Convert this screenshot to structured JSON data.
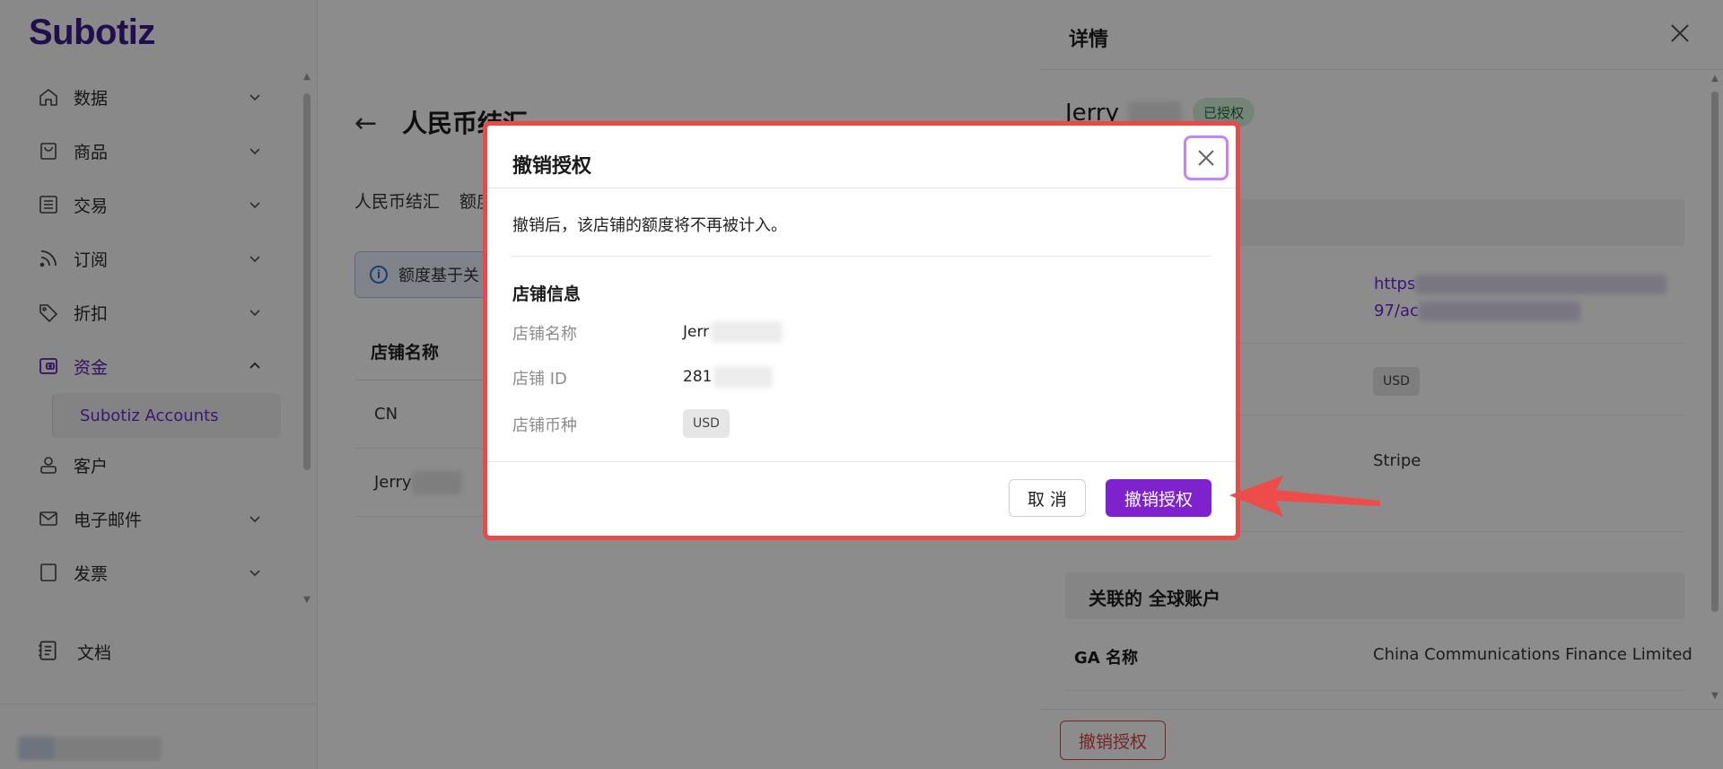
{
  "app": {
    "logo": "Subotiz"
  },
  "sidebar": {
    "items": [
      {
        "label": "数据",
        "icon": "home-icon"
      },
      {
        "label": "商品",
        "icon": "store-icon"
      },
      {
        "label": "交易",
        "icon": "list-icon"
      },
      {
        "label": "订阅",
        "icon": "rss-icon"
      },
      {
        "label": "折扣",
        "icon": "tag-icon"
      },
      {
        "label": "资金",
        "icon": "wallet-icon",
        "expanded": true
      },
      {
        "label": "客户",
        "icon": "user-icon"
      },
      {
        "label": "电子邮件",
        "icon": "mail-icon"
      },
      {
        "label": "发票",
        "icon": "invoice-icon"
      }
    ],
    "subitem": "Subotiz Accounts",
    "docs": "文档"
  },
  "main": {
    "title": "人民币结汇",
    "breadcrumb": [
      "人民币结汇",
      "额度"
    ],
    "info": "额度基于关",
    "table": {
      "header": "店铺名称",
      "rows": [
        "CN",
        "Jerry"
      ]
    }
  },
  "drawer": {
    "title": "详情",
    "store_name": "Jerry",
    "status": "已授权",
    "link_line1": "https",
    "link_line2": "97/ac",
    "currency": "USD",
    "provider": "Stripe",
    "section_accounts": "关联的 全球账户",
    "ga_label": "GA 名称",
    "ga_value": "China Communications Finance Limited",
    "revoke_button": "撤销授权"
  },
  "modal": {
    "title": "撤销授权",
    "description": "撤销后，该店铺的额度将不再被计入。",
    "section": "店铺信息",
    "fields": [
      {
        "label": "店铺名称",
        "value": "Jerr"
      },
      {
        "label": "店铺 ID",
        "value": "281"
      },
      {
        "label": "店铺币种",
        "value": "USD"
      }
    ],
    "cancel": "取 消",
    "confirm": "撤销授权"
  },
  "colors": {
    "brand": "#3b1a8c",
    "primary": "#7e22ce",
    "danger": "#e84a4a",
    "success_bg": "#d6f0dc"
  }
}
